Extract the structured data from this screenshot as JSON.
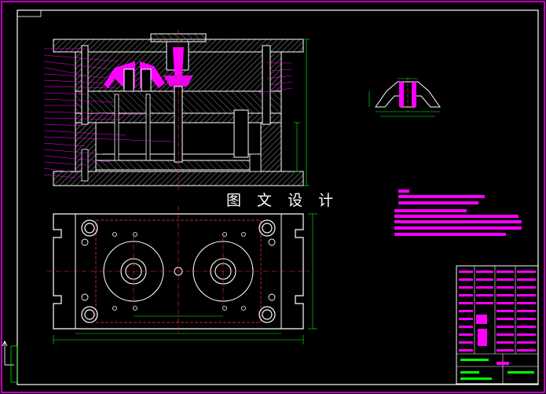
{
  "watermark": "图 文 设 计",
  "colors": {
    "background": "#000000",
    "outline": "#ffffff",
    "part": "#ffffff",
    "dimension": "#00ff00",
    "centerline": "#ff3333",
    "note": "#ff00ff",
    "hatch": "#c8c8c8",
    "frame_border": "#ff00ff"
  },
  "icons": {
    "ucs": "ucs-axis-icon"
  }
}
